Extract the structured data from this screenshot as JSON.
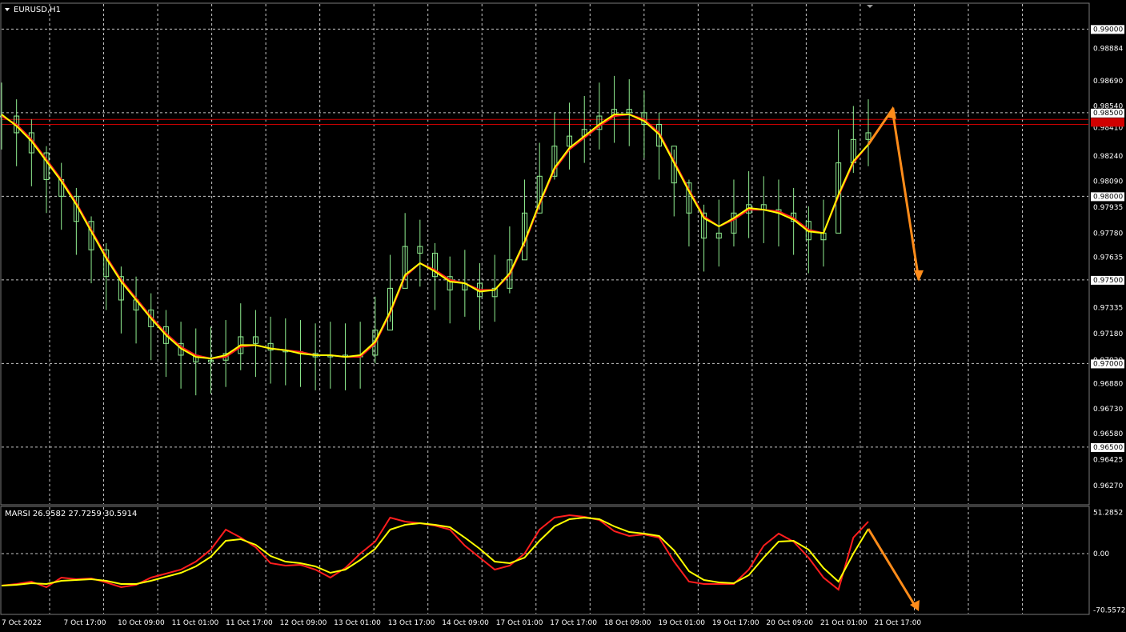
{
  "window": {
    "symbol_title": "EURUSD,H1",
    "indicator_title": "MARSI 26.9582 27.7259 30.5914"
  },
  "colors": {
    "background": "#000000",
    "grid": "#c8c8c8",
    "candle": "#90ee90",
    "ma_red": "#ff1e1e",
    "ma_yellow": "#ffff00",
    "hline": "#c80000",
    "arrow": "#ff8c1a",
    "axis_text": "#ffffff"
  },
  "chart_data": [
    {
      "type": "line",
      "title": "EURUSD,H1",
      "price_axis": {
        "ylim": [
          0.9616,
          0.9915
        ],
        "tick_labels": [
          "0.98884",
          "0.98690",
          "0.98540",
          "0.98410",
          "0.98240",
          "0.98090",
          "0.97935",
          "0.97780",
          "0.97635",
          "0.97335",
          "0.97180",
          "0.97020",
          "0.96880",
          "0.96730",
          "0.96580",
          "0.96425",
          "0.96270"
        ],
        "tick_values": [
          0.98884,
          0.9869,
          0.9854,
          0.9841,
          0.9824,
          0.9809,
          0.97935,
          0.9778,
          0.97635,
          0.97335,
          0.9718,
          0.9702,
          0.9688,
          0.9673,
          0.9658,
          0.96425,
          0.9627
        ],
        "boxed_labels": [
          "0.99000",
          "0.98500",
          "0.98000",
          "0.97500",
          "0.97000",
          "0.96500"
        ],
        "boxed_values": [
          0.99,
          0.985,
          0.98,
          0.975,
          0.97,
          0.965
        ],
        "red_box_value": 0.98445
      },
      "time_axis": {
        "labels": [
          "7 Oct 2022",
          "7 Oct 17:00",
          "10 Oct 09:00",
          "11 Oct 01:00",
          "11 Oct 17:00",
          "12 Oct 09:00",
          "13 Oct 01:00",
          "13 Oct 17:00",
          "14 Oct 09:00",
          "17 Oct 01:00",
          "17 Oct 17:00",
          "18 Oct 09:00",
          "19 Oct 01:00",
          "19 Oct 17:00",
          "20 Oct 09:00",
          "21 Oct 01:00",
          "21 Oct 17:00"
        ],
        "bars_per_label": 16
      },
      "grid": true,
      "horizontal_lines": [
        0.9846,
        0.9843
      ],
      "series": [
        {
          "style": "candles",
          "close": [
            0.9848,
            0.9838,
            0.9826,
            0.981,
            0.98,
            0.9785,
            0.9768,
            0.9752,
            0.9738,
            0.9732,
            0.9722,
            0.9712,
            0.9705,
            0.9701,
            0.9702,
            0.9706,
            0.9716,
            0.9712,
            0.9708,
            0.9707,
            0.9706,
            0.9704,
            0.9705,
            0.9704,
            0.9705,
            0.972,
            0.9745,
            0.977,
            0.9766,
            0.9752,
            0.9744,
            0.9748,
            0.974,
            0.9745,
            0.9762,
            0.979,
            0.9812,
            0.983,
            0.9836,
            0.984,
            0.9848,
            0.9852,
            0.985,
            0.9843,
            0.983,
            0.9808,
            0.979,
            0.9775,
            0.9778,
            0.979,
            0.9795,
            0.9792,
            0.979,
            0.9785,
            0.9774,
            0.9778,
            0.982,
            0.9834,
            0.9838
          ],
          "high": [
            0.9868,
            0.9858,
            0.9846,
            0.983,
            0.982,
            0.9805,
            0.9788,
            0.9772,
            0.9758,
            0.9752,
            0.9742,
            0.9732,
            0.9725,
            0.9721,
            0.9722,
            0.9726,
            0.9736,
            0.9732,
            0.9728,
            0.9727,
            0.9726,
            0.9724,
            0.9725,
            0.9724,
            0.9725,
            0.974,
            0.9765,
            0.979,
            0.9786,
            0.9772,
            0.9764,
            0.9768,
            0.976,
            0.9765,
            0.9782,
            0.981,
            0.9832,
            0.985,
            0.9856,
            0.986,
            0.9868,
            0.9872,
            0.987,
            0.9863,
            0.985,
            0.9828,
            0.981,
            0.9795,
            0.9798,
            0.981,
            0.9815,
            0.9812,
            0.981,
            0.9805,
            0.9794,
            0.9798,
            0.984,
            0.9854,
            0.9858
          ],
          "low": [
            0.9828,
            0.9818,
            0.9806,
            0.979,
            0.978,
            0.9765,
            0.9748,
            0.9732,
            0.9718,
            0.9712,
            0.9702,
            0.9692,
            0.9685,
            0.9681,
            0.9682,
            0.9686,
            0.9696,
            0.9692,
            0.9688,
            0.9687,
            0.9686,
            0.9684,
            0.9685,
            0.9684,
            0.9685,
            0.97,
            0.9725,
            0.975,
            0.9746,
            0.9732,
            0.9724,
            0.9728,
            0.972,
            0.9725,
            0.9742,
            0.977,
            0.9792,
            0.981,
            0.9816,
            0.982,
            0.9828,
            0.9832,
            0.983,
            0.9823,
            0.981,
            0.9788,
            0.977,
            0.9755,
            0.9758,
            0.977,
            0.9775,
            0.9772,
            0.977,
            0.9765,
            0.9754,
            0.9758,
            0.98,
            0.9814,
            0.9818
          ]
        },
        {
          "style": "line",
          "color": "#ff1e1e",
          "values": [
            0.9848,
            0.9843,
            0.9834,
            0.9822,
            0.981,
            0.9796,
            0.978,
            0.9764,
            0.975,
            0.9739,
            0.9728,
            0.9718,
            0.971,
            0.9705,
            0.9703,
            0.9704,
            0.971,
            0.9711,
            0.9709,
            0.9708,
            0.9707,
            0.9705,
            0.9705,
            0.9704,
            0.9704,
            0.9712,
            0.973,
            0.9752,
            0.976,
            0.9756,
            0.975,
            0.9748,
            0.9744,
            0.9744,
            0.9753,
            0.9772,
            0.9795,
            0.9816,
            0.9828,
            0.9835,
            0.9842,
            0.9848,
            0.9849,
            0.9846,
            0.9838,
            0.9821,
            0.9804,
            0.9788,
            0.9782,
            0.9786,
            0.9792,
            0.9792,
            0.9791,
            0.9787,
            0.978,
            0.9778,
            0.98,
            0.982,
            0.9831
          ]
        },
        {
          "style": "line",
          "color": "#ffff00",
          "values": [
            0.9849,
            0.9842,
            0.9833,
            0.9821,
            0.9809,
            0.9795,
            0.9779,
            0.9763,
            0.9749,
            0.9738,
            0.9727,
            0.9717,
            0.9709,
            0.9704,
            0.9703,
            0.9705,
            0.9711,
            0.9711,
            0.9709,
            0.9708,
            0.9706,
            0.9705,
            0.9705,
            0.9704,
            0.9705,
            0.9713,
            0.9731,
            0.9753,
            0.976,
            0.9755,
            0.9749,
            0.9748,
            0.9743,
            0.9744,
            0.9754,
            0.9773,
            0.9796,
            0.9817,
            0.9829,
            0.9836,
            0.9843,
            0.9849,
            0.9849,
            0.9845,
            0.9837,
            0.982,
            0.9803,
            0.9787,
            0.9782,
            0.9787,
            0.9793,
            0.9792,
            0.979,
            0.9786,
            0.9779,
            0.9778,
            0.9801,
            0.9821,
            0.9831
          ]
        }
      ],
      "arrow_path": [
        [
          0.9831,
          0
        ],
        [
          0.9852,
          0
        ],
        [
          0.975,
          0
        ]
      ]
    },
    {
      "type": "line",
      "title": "MARSI 26.9582 27.7259 30.5914",
      "ylim": [
        -75,
        58
      ],
      "tick_labels": [
        "51.2852",
        "0.00",
        "-70.5572"
      ],
      "tick_values": [
        51.2852,
        0,
        -70.5572
      ],
      "zero_line": true,
      "series": [
        {
          "color": "#ff1e1e",
          "values": [
            -40,
            -38,
            -35,
            -42,
            -30,
            -32,
            -31,
            -36,
            -42,
            -39,
            -30,
            -25,
            -20,
            -10,
            5,
            30,
            20,
            8,
            -12,
            -15,
            -14,
            -20,
            -30,
            -18,
            0,
            15,
            45,
            40,
            38,
            35,
            30,
            10,
            -5,
            -20,
            -15,
            0,
            30,
            45,
            48,
            46,
            42,
            28,
            22,
            24,
            20,
            -10,
            -35,
            -38,
            -38,
            -38,
            -20,
            10,
            25,
            15,
            -5,
            -30,
            -45,
            20,
            40
          ]
        },
        {
          "color": "#ffff00",
          "values": [
            -40,
            -39,
            -37,
            -38,
            -34,
            -33,
            -32,
            -34,
            -38,
            -38,
            -34,
            -29,
            -24,
            -16,
            -4,
            16,
            18,
            11,
            -3,
            -10,
            -12,
            -16,
            -24,
            -20,
            -8,
            6,
            30,
            36,
            38,
            36,
            33,
            20,
            6,
            -10,
            -12,
            -5,
            16,
            34,
            43,
            45,
            43,
            34,
            27,
            25,
            22,
            4,
            -22,
            -33,
            -36,
            -37,
            -27,
            -5,
            15,
            16,
            5,
            -18,
            -35,
            0,
            31
          ]
        }
      ],
      "arrow_to": -68
    }
  ]
}
